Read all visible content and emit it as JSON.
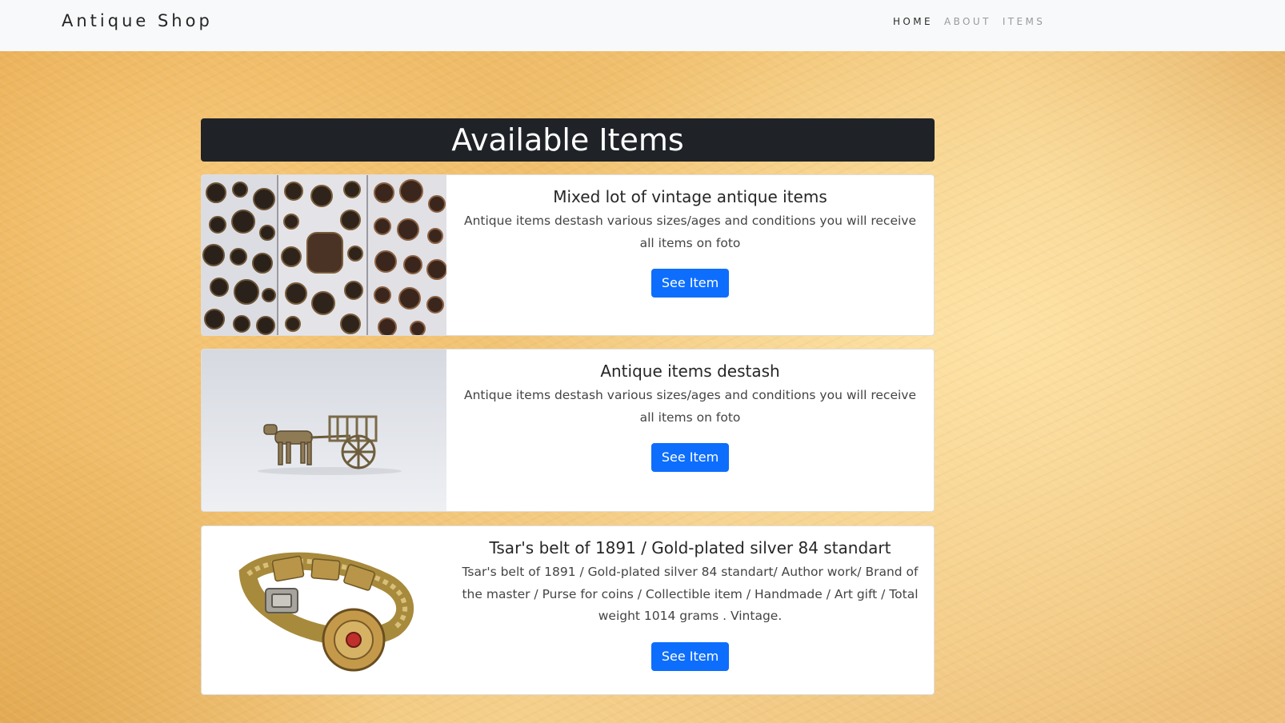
{
  "navbar": {
    "brand": "Antique Shop",
    "links": [
      {
        "label": "HOME",
        "active": true
      },
      {
        "label": "ABOUT",
        "active": false
      },
      {
        "label": "ITEMS",
        "active": false
      }
    ]
  },
  "main": {
    "heading": "Available Items",
    "items": [
      {
        "title": "Mixed lot of vintage antique items",
        "description": "Antique items destash various sizes/ages and conditions you will receive all items on foto",
        "button_label": "See Item",
        "image": "vintage-buttons-photo"
      },
      {
        "title": "Antique items destash",
        "description": "Antique items destash various sizes/ages and conditions you will receive all items on foto",
        "button_label": "See Item",
        "image": "brass-horse-cart-photo"
      },
      {
        "title": "Tsar's belt of 1891 / Gold-plated silver 84 standart",
        "description": "Tsar's belt of 1891 / Gold-plated silver 84 standart/ Author work/ Brand of the master / Purse for coins / Collectible item / Handmade / Art gift / Total weight 1014 grams . Vintage.",
        "button_label": "See Item",
        "image": "gold-belt-photo"
      }
    ]
  },
  "colors": {
    "nav_bg": "#f8f9fa",
    "heading_bg": "#1f2328",
    "button_bg": "#0d6efd",
    "background_gold": "#f0c06e"
  }
}
